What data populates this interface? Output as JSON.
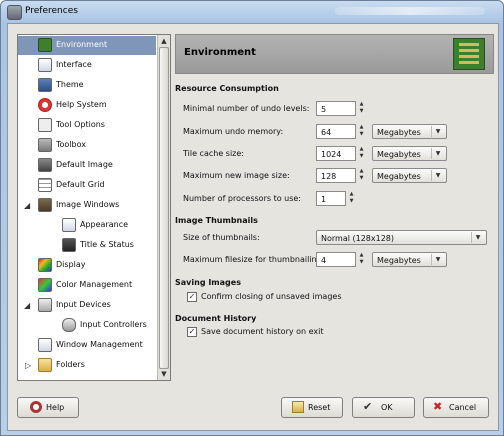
{
  "window": {
    "title": "Preferences"
  },
  "sidebar": {
    "items": [
      {
        "label": "Environment",
        "icon": "environment-icon",
        "selected": true
      },
      {
        "label": "Interface",
        "icon": "interface-icon"
      },
      {
        "label": "Theme",
        "icon": "theme-icon"
      },
      {
        "label": "Help System",
        "icon": "help-system-icon"
      },
      {
        "label": "Tool Options",
        "icon": "tool-options-icon"
      },
      {
        "label": "Toolbox",
        "icon": "toolbox-icon"
      },
      {
        "label": "Default Image",
        "icon": "default-image-icon"
      },
      {
        "label": "Default Grid",
        "icon": "default-grid-icon"
      },
      {
        "label": "Image Windows",
        "icon": "image-windows-icon",
        "expanded": true
      },
      {
        "label": "Appearance",
        "icon": "appearance-icon"
      },
      {
        "label": "Title & Status",
        "icon": "title-status-icon"
      },
      {
        "label": "Display",
        "icon": "display-icon"
      },
      {
        "label": "Color Management",
        "icon": "color-management-icon"
      },
      {
        "label": "Input Devices",
        "icon": "input-devices-icon",
        "expanded": true
      },
      {
        "label": "Input Controllers",
        "icon": "input-controllers-icon"
      },
      {
        "label": "Window Management",
        "icon": "window-management-icon"
      },
      {
        "label": "Folders",
        "icon": "folders-icon",
        "expanded": false
      }
    ]
  },
  "header": {
    "title": "Environment",
    "icon": "environment-chip-icon"
  },
  "resource": {
    "title": "Resource Consumption",
    "undo_levels_label": "Minimal number of undo levels:",
    "undo_levels_value": "5",
    "undo_memory_label": "Maximum undo memory:",
    "undo_memory_value": "64",
    "undo_memory_unit": "Megabytes",
    "tile_cache_label": "Tile cache size:",
    "tile_cache_value": "1024",
    "tile_cache_unit": "Megabytes",
    "max_image_label": "Maximum new image size:",
    "max_image_value": "128",
    "max_image_unit": "Megabytes",
    "processors_label": "Number of processors to use:",
    "processors_value": "1"
  },
  "thumbnails": {
    "title": "Image Thumbnails",
    "size_label": "Size of thumbnails:",
    "size_value": "Normal (128x128)",
    "filesize_label": "Maximum filesize for thumbnailing:",
    "filesize_value": "4",
    "filesize_unit": "Megabytes"
  },
  "saving": {
    "title": "Saving Images",
    "confirm_label": "Confirm closing of unsaved images",
    "confirm_checked": true
  },
  "history": {
    "title": "Document History",
    "save_label": "Save document history on exit",
    "save_checked": true
  },
  "buttons": {
    "help": "Help",
    "reset": "Reset",
    "ok": "OK",
    "cancel": "Cancel"
  }
}
